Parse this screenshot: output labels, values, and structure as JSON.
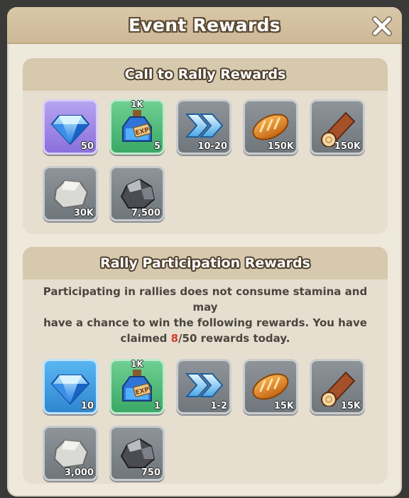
{
  "modal": {
    "title": "Event Rewards"
  },
  "rally": {
    "title": "Call to Rally Rewards",
    "items": [
      {
        "icon": "diamond-icon",
        "qty": "50"
      },
      {
        "icon": "exp-potion-icon",
        "tag": "1K",
        "qty": "5"
      },
      {
        "icon": "speedup-arrows-icon",
        "qty": "10-20"
      },
      {
        "icon": "bread-icon",
        "qty": "150K"
      },
      {
        "icon": "wood-log-icon",
        "qty": "150K"
      },
      {
        "icon": "stone-icon",
        "qty": "30K"
      },
      {
        "icon": "iron-ore-icon",
        "qty": "7,500"
      }
    ]
  },
  "participation": {
    "title": "Rally Participation Rewards",
    "desc_line1": "Participating in rallies does not consume stamina and may",
    "desc_line2": "have a chance to win the following rewards. You have",
    "desc_line3_pre": "claimed ",
    "claimed": "8",
    "desc_line3_post": "/50 rewards today.",
    "items": [
      {
        "icon": "diamond-icon",
        "qty": "10"
      },
      {
        "icon": "exp-potion-icon",
        "tag": "1K",
        "qty": "1"
      },
      {
        "icon": "speedup-arrows-icon",
        "qty": "1-2"
      },
      {
        "icon": "bread-icon",
        "qty": "15K"
      },
      {
        "icon": "wood-log-icon",
        "qty": "15K"
      },
      {
        "icon": "stone-icon",
        "qty": "3,000"
      },
      {
        "icon": "iron-ore-icon",
        "qty": "750"
      }
    ]
  },
  "colors": {
    "panel_bg": "#efe9dc",
    "header_bg": "#d9c7a8",
    "highlight": "#d23d2a"
  }
}
